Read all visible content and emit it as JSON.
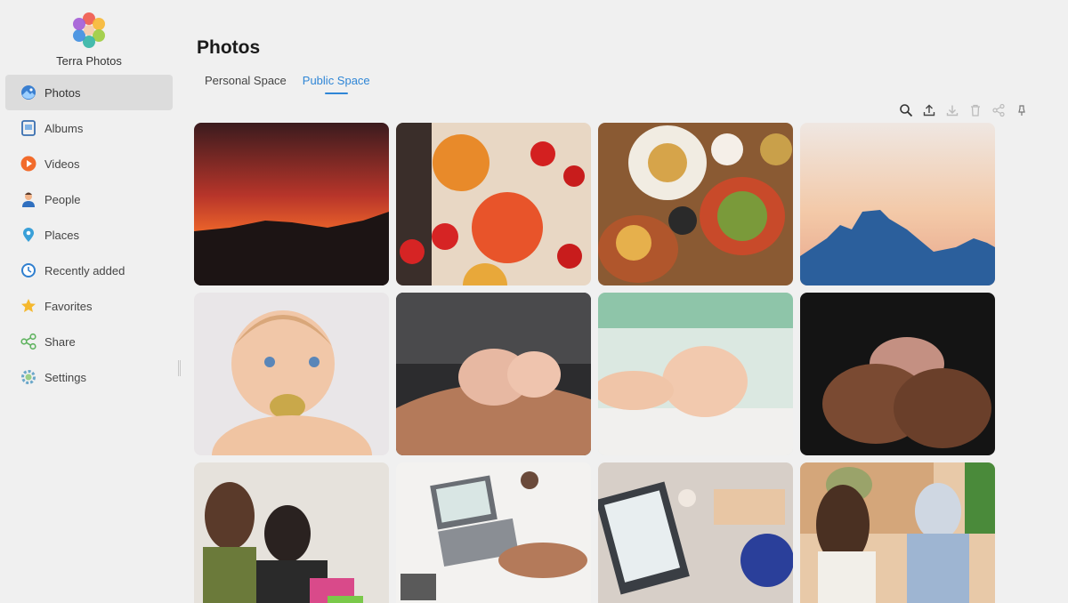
{
  "app": {
    "name": "Terra Photos"
  },
  "sidebar": {
    "items": [
      {
        "label": "Photos",
        "icon": "photos-icon",
        "active": true
      },
      {
        "label": "Albums",
        "icon": "albums-icon"
      },
      {
        "label": "Videos",
        "icon": "videos-icon"
      },
      {
        "label": "People",
        "icon": "people-icon"
      },
      {
        "label": "Places",
        "icon": "places-icon"
      },
      {
        "label": "Recently added",
        "icon": "recent-icon"
      },
      {
        "label": "Favorites",
        "icon": "star-icon"
      },
      {
        "label": "Share",
        "icon": "share-icon"
      },
      {
        "label": "Settings",
        "icon": "gear-icon"
      }
    ]
  },
  "main": {
    "title": "Photos",
    "tabs": [
      {
        "label": "Personal Space",
        "active": false
      },
      {
        "label": "Public Space",
        "active": true
      }
    ],
    "toolbar": [
      "search-icon",
      "upload-icon",
      "download-icon",
      "delete-icon",
      "share-icon",
      "pin-icon"
    ]
  },
  "colors": {
    "accent": "#2f86d6",
    "active_bg": "#dcdcdc",
    "background": "#f0f0f0"
  }
}
